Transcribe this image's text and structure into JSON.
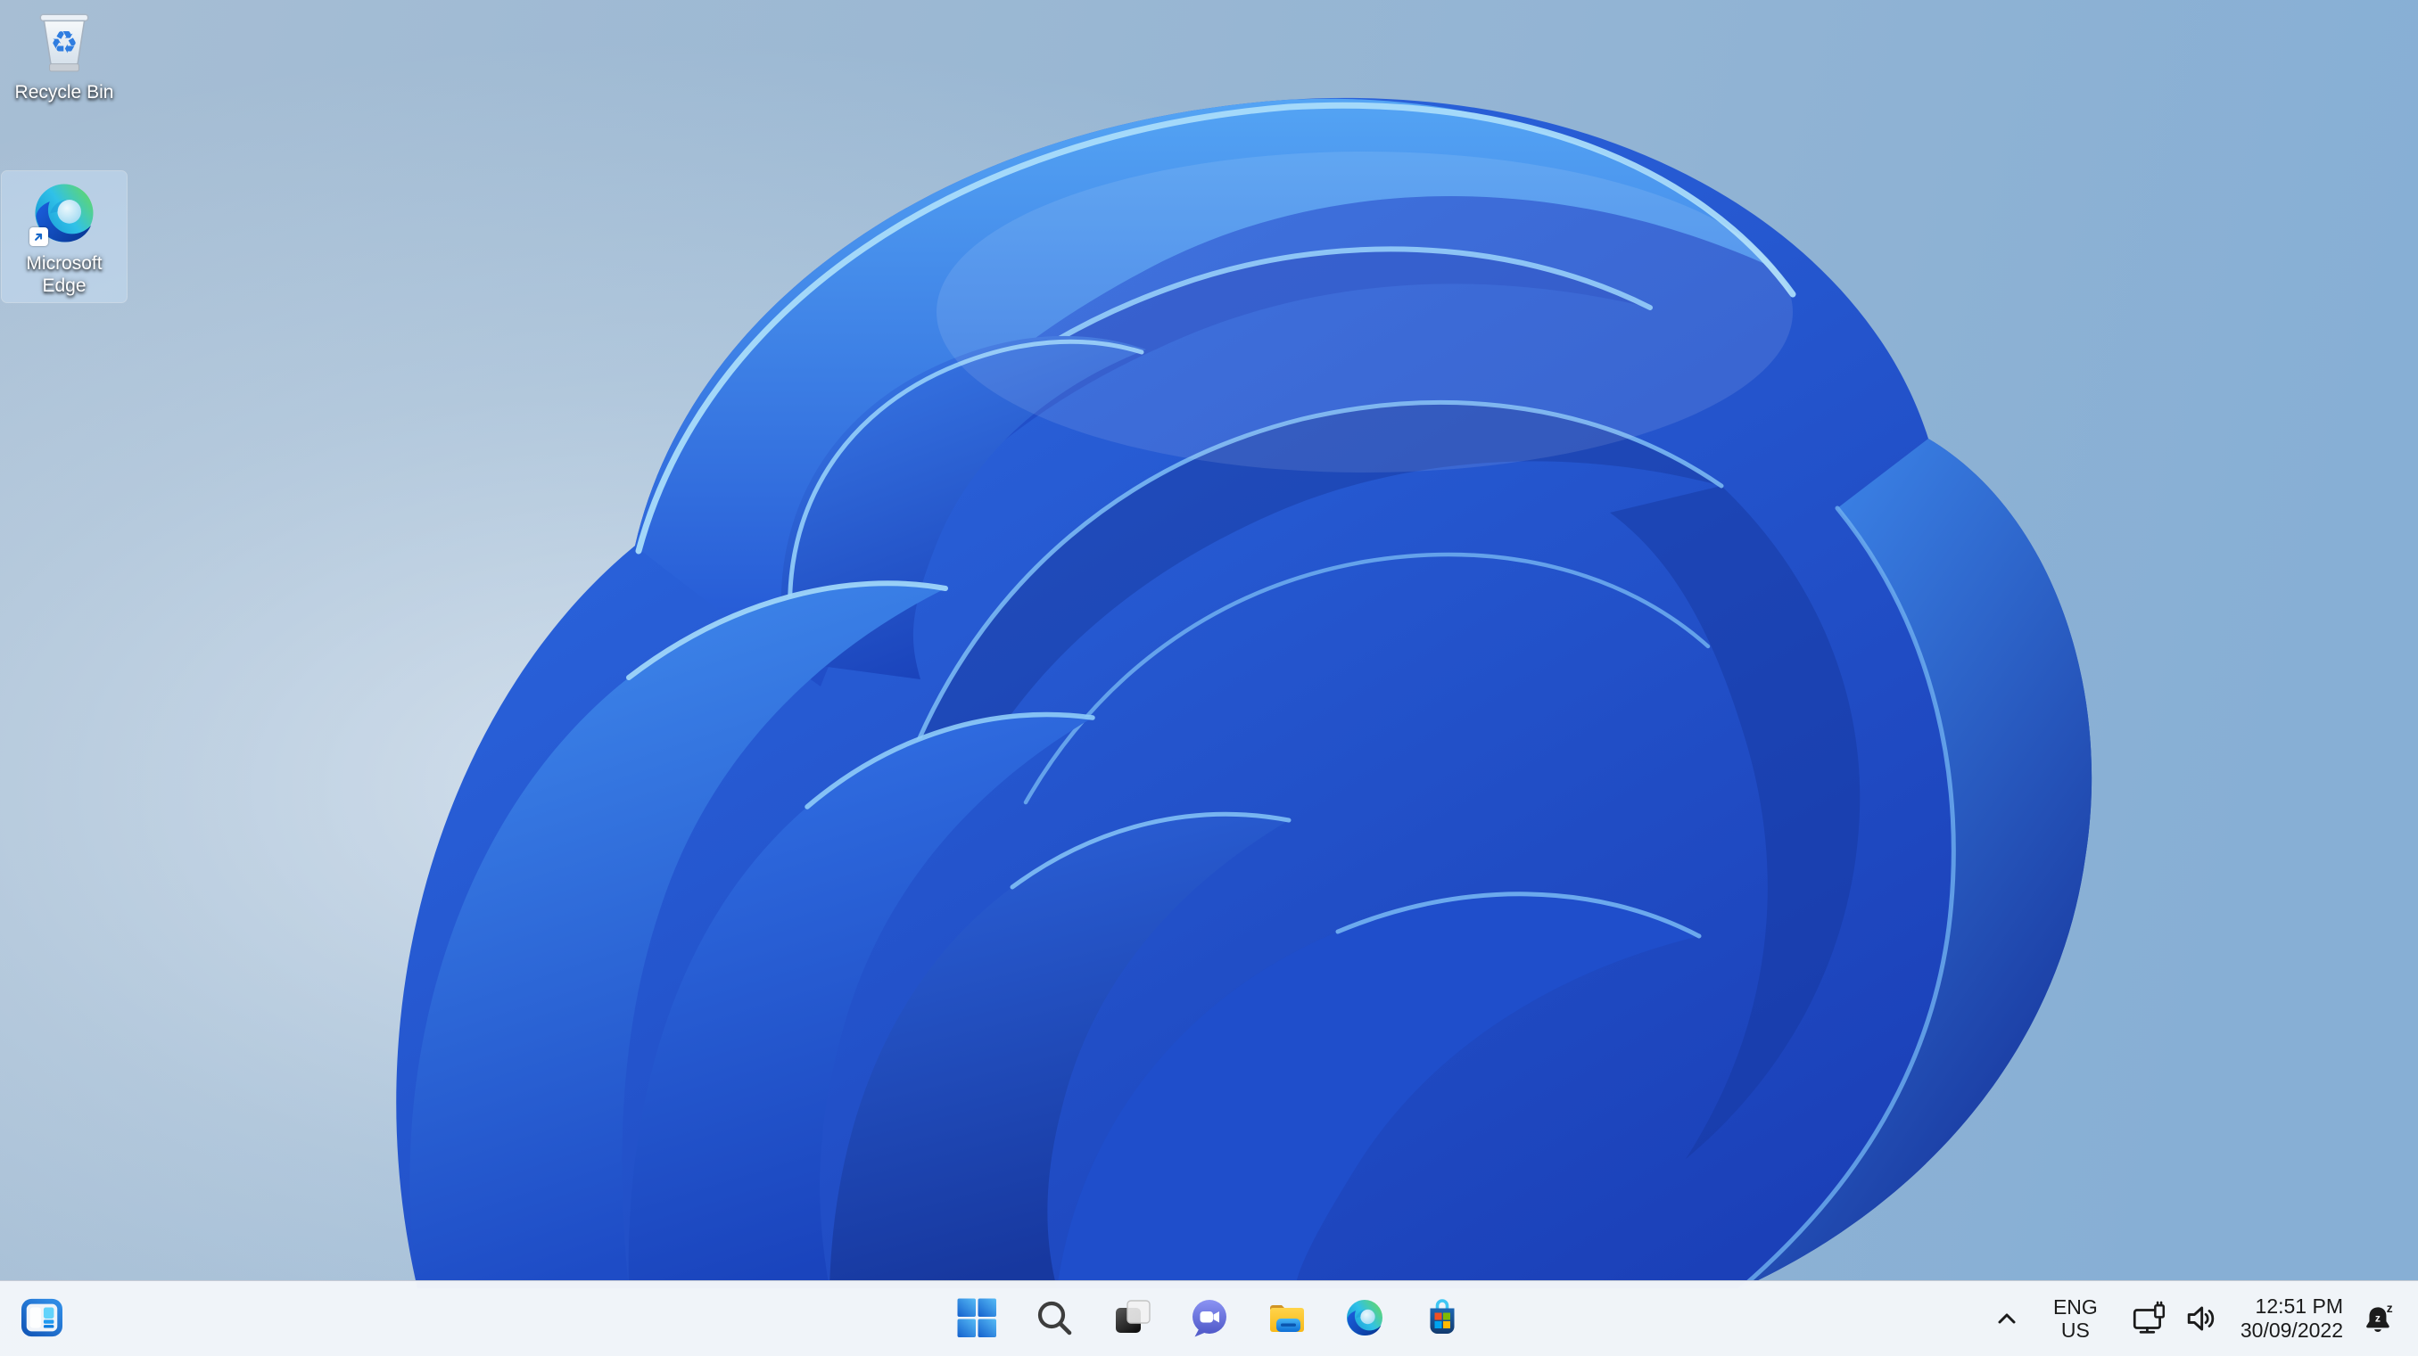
{
  "desktop": {
    "icons": [
      {
        "id": "recycle-bin",
        "label": "Recycle Bin",
        "selected": false
      },
      {
        "id": "microsoft-edge",
        "label": "Microsoft Edge",
        "selected": true
      }
    ]
  },
  "taskbar": {
    "buttons": [
      {
        "id": "widgets",
        "icon": "widgets-icon"
      },
      {
        "id": "start",
        "icon": "windows-start-icon"
      },
      {
        "id": "search",
        "icon": "search-icon"
      },
      {
        "id": "task-view",
        "icon": "task-view-icon"
      },
      {
        "id": "chat",
        "icon": "teams-chat-icon"
      },
      {
        "id": "file-explorer",
        "icon": "folder-icon"
      },
      {
        "id": "edge",
        "icon": "edge-swirl-icon"
      },
      {
        "id": "store",
        "icon": "store-bag-icon"
      }
    ],
    "colors": {
      "background": "#f2f5f9",
      "icon_foreground": "#1b1b1b"
    }
  },
  "tray": {
    "icons": [
      "hidden-icons-chevron",
      "network-icon",
      "volume-icon",
      "do-not-disturb-bell-icon"
    ],
    "language": {
      "line1": "ENG",
      "line2": "US"
    },
    "clock": {
      "time": "12:51 PM",
      "date": "30/09/2022"
    }
  },
  "wallpaper": {
    "name": "windows-11-bloom",
    "colors": {
      "sky_left": "#a7bed4",
      "sky_right": "#87afd5",
      "bloom_deep": "#1a3eb6",
      "bloom_mid": "#2f6ee6",
      "bloom_bright": "#4f9ef2",
      "bloom_rim": "#a9dcfa"
    }
  }
}
